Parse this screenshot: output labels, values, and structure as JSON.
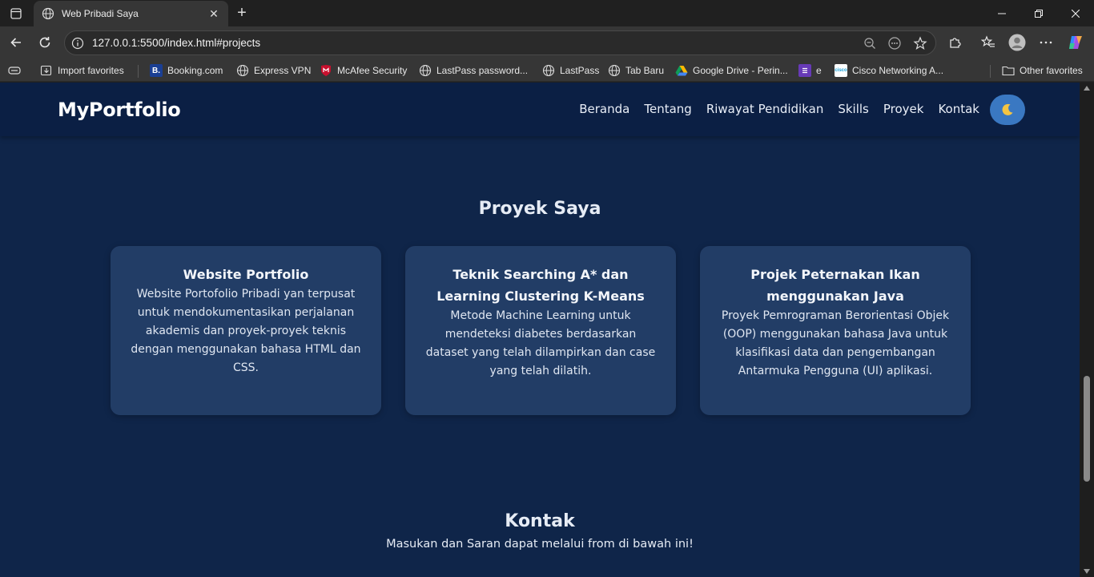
{
  "browser": {
    "tab_title": "Web Pribadi Saya",
    "url": "127.0.0.1:5500/index.html#projects",
    "bookmarks": [
      {
        "label": "Import favorites",
        "icon": "import-icon"
      },
      {
        "label": "Booking.com",
        "icon": "booking-icon"
      },
      {
        "label": "Express VPN",
        "icon": "globe-icon"
      },
      {
        "label": "McAfee Security",
        "icon": "mcafee-icon"
      },
      {
        "label": "LastPass password...",
        "icon": "globe-icon"
      },
      {
        "label": "LastPass",
        "icon": "globe-icon"
      },
      {
        "label": "Tab Baru",
        "icon": "globe-icon"
      },
      {
        "label": "Google Drive - Perin...",
        "icon": "google-drive-icon"
      },
      {
        "label": "e",
        "icon": "forms-icon"
      },
      {
        "label": "Cisco Networking A...",
        "icon": "cisco-icon"
      }
    ],
    "other_favorites": "Other favorites"
  },
  "site": {
    "brand": "MyPortfolio",
    "nav": [
      "Beranda",
      "Tentang",
      "Riwayat Pendidikan",
      "Skills",
      "Proyek",
      "Kontak"
    ],
    "theme_toggle_icon": "🌙"
  },
  "projects": {
    "title": "Proyek Saya",
    "cards": [
      {
        "title": "Website Portfolio",
        "desc": "Website Portofolio Pribadi yan terpusat untuk mendokumentasikan perjalanan akademis dan proyek-proyek teknis dengan menggunakan bahasa HTML dan CSS."
      },
      {
        "title": "Teknik Searching A* dan Learning Clustering K-Means",
        "desc": "Metode Machine Learning untuk mendeteksi diabetes berdasarkan dataset yang telah dilampirkan dan case yang telah dilatih."
      },
      {
        "title": "Projek Peternakan Ikan menggunakan Java",
        "desc": "Proyek Pemrograman Berorientasi Objek (OOP) menggunakan bahasa Java untuk klasifikasi data dan pengembangan Antarmuka Pengguna (UI) aplikasi."
      }
    ]
  },
  "contact": {
    "title": "Kontak",
    "subtitle": "Masukan dan Saran dapat melalui from di bawah ini!"
  }
}
